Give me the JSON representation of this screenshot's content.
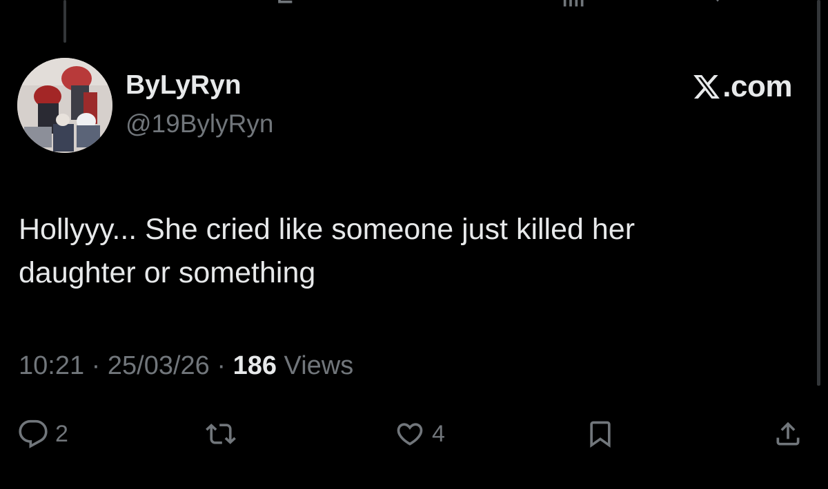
{
  "header": {
    "display_name": "ByLyRyn",
    "handle": "@19BylyRyn",
    "brand_text": ".com"
  },
  "tweet": {
    "text_line1": "Hollyyy... She cried like someone just killed her",
    "text_line2": "daughter or something"
  },
  "meta": {
    "time": "10:21",
    "sep1": " · ",
    "date": "25/03/26",
    "sep2": " · ",
    "views_count": "186",
    "views_label": " Views"
  },
  "actions": {
    "reply_count": "2",
    "like_count": "4"
  },
  "colors": {
    "background": "#000000",
    "primary_text": "#e7e9ea",
    "secondary_text": "#71767b",
    "divider": "#333639"
  },
  "icons": [
    "reply-icon",
    "retweet-icon",
    "like-icon",
    "bookmark-icon",
    "share-icon",
    "x-logo-icon"
  ]
}
